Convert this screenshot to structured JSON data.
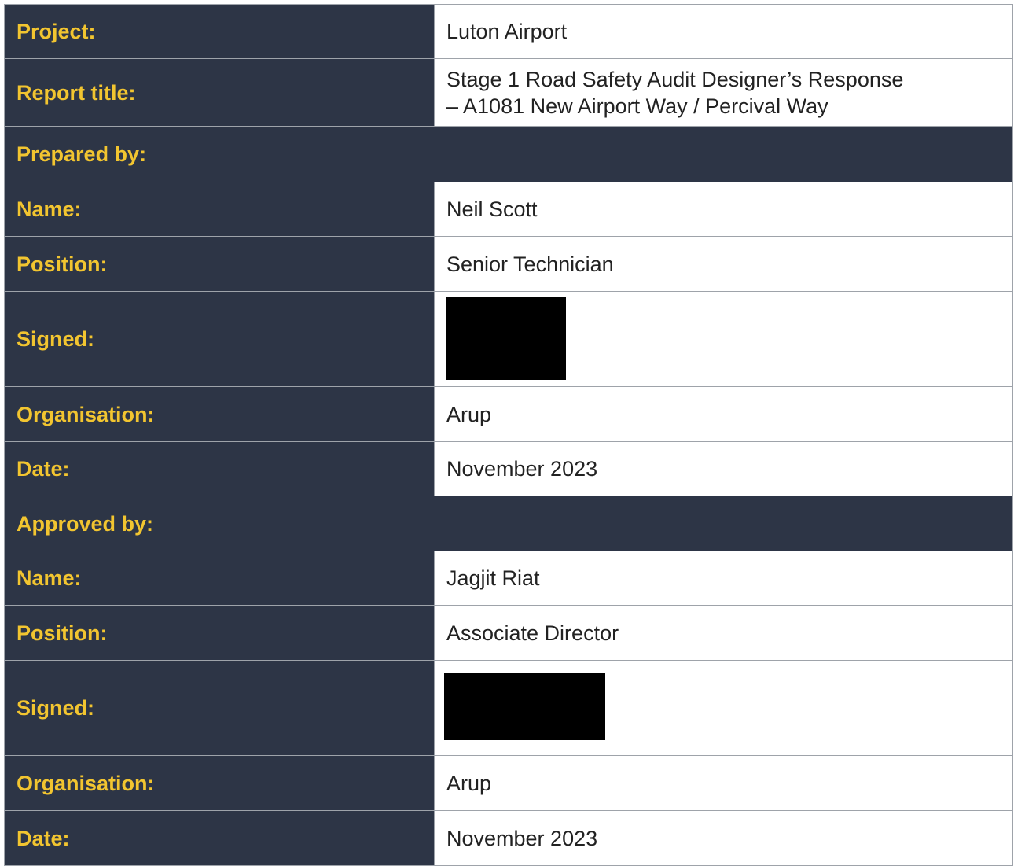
{
  "document": {
    "project_label": "Project:",
    "project_value": "Luton Airport",
    "report_title_label": "Report title:",
    "report_title_line1": "Stage 1 Road Safety Audit Designer’s Response",
    "report_title_line2": "– A1081 New Airport Way / Percival Way",
    "prepared": {
      "heading": "Prepared by:",
      "name_label": "Name:",
      "name_value": "Neil Scott",
      "position_label": "Position:",
      "position_value": "Senior Technician",
      "signed_label": "Signed:",
      "organisation_label": "Organisation:",
      "organisation_value": "Arup",
      "date_label": "Date:",
      "date_value": "November 2023"
    },
    "approved": {
      "heading": "Approved by:",
      "name_label": "Name:",
      "name_value": "Jagjit Riat",
      "position_label": "Position:",
      "position_value": "Associate Director",
      "signed_label": "Signed:",
      "organisation_label": "Organisation:",
      "organisation_value": "Arup",
      "date_label": "Date:",
      "date_value": "November 2023"
    }
  },
  "colors": {
    "label_background": "#2d3546",
    "label_text": "#f2c530",
    "value_text": "#222222",
    "border": "#9ea3aa"
  }
}
